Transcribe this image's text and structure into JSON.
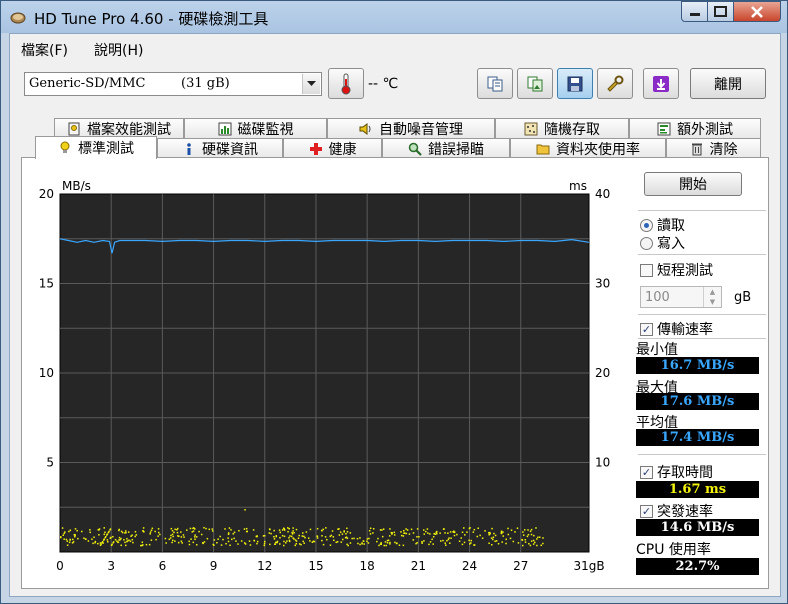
{
  "window": {
    "title": "HD Tune Pro 4.60 - 硬碟檢測工具"
  },
  "menu": {
    "file": "檔案(F)",
    "help": "說明(H)"
  },
  "toolbar": {
    "drive_name": "Generic-SD/MMC",
    "drive_size": "(31 gB)",
    "temperature": "-- ℃",
    "exit_label": "離開"
  },
  "tabs_top": [
    "檔案效能測試",
    "磁碟監視",
    "自動噪音管理",
    "隨機存取",
    "額外測試"
  ],
  "tabs_bottom": [
    "標準測試",
    "硬碟資訊",
    "健康",
    "錯誤掃瞄",
    "資料夾使用率",
    "清除"
  ],
  "colors": {
    "accent": "#3aa7ff",
    "access_dots": "#f4f40b",
    "chart_bg": "#262626"
  },
  "side": {
    "start_label": "開始",
    "read_label": "讀取",
    "write_label": "寫入",
    "read_selected": true,
    "short_test_label": "短程測試",
    "short_test_value": "100",
    "short_test_unit": "gB",
    "transfer_label": "傳輸速率",
    "min_label": "最小值",
    "min_value": "16.7 MB/s",
    "max_label": "最大值",
    "max_value": "17.6 MB/s",
    "avg_label": "平均值",
    "avg_value": "17.4 MB/s",
    "access_label": "存取時間",
    "access_value": "1.67 ms",
    "burst_label": "突發速率",
    "burst_value": "14.6 MB/s",
    "cpu_label": "CPU 使用率",
    "cpu_value": "22.7%"
  },
  "chart_data": {
    "type": "line",
    "ylabel_left": "MB/s",
    "ylabel_right": "ms",
    "xlabel": "gB",
    "xlim": [
      0,
      31
    ],
    "ylim_left": [
      0,
      20
    ],
    "ylim_right": [
      0,
      40
    ],
    "x_ticks": [
      "0",
      "3",
      "6",
      "9",
      "12",
      "15",
      "18",
      "21",
      "24",
      "27",
      "31gB"
    ],
    "y_ticks_left": [
      "20",
      "15",
      "10",
      "5"
    ],
    "y_ticks_right": [
      "40",
      "30",
      "20",
      "10"
    ],
    "grid": true,
    "series": [
      {
        "name": "傳輸速率",
        "axis": "left",
        "x": [
          0,
          0.5,
          1,
          1.5,
          2,
          2.5,
          2.9,
          3.05,
          3.2,
          3.5,
          4,
          5,
          6,
          7,
          8,
          9,
          10,
          11,
          12,
          13,
          14,
          15,
          16,
          17,
          18,
          19,
          20,
          21,
          22,
          23,
          24,
          25,
          26,
          27,
          28,
          29,
          30,
          31
        ],
        "values": [
          17.5,
          17.4,
          17.3,
          17.4,
          17.3,
          17.4,
          17.35,
          16.7,
          17.3,
          17.4,
          17.4,
          17.4,
          17.35,
          17.4,
          17.4,
          17.35,
          17.4,
          17.4,
          17.35,
          17.4,
          17.4,
          17.35,
          17.4,
          17.4,
          17.4,
          17.35,
          17.4,
          17.4,
          17.35,
          17.4,
          17.4,
          17.4,
          17.35,
          17.4,
          17.4,
          17.35,
          17.45,
          17.3
        ]
      },
      {
        "name": "存取時間",
        "axis": "right",
        "type": "scatter",
        "x_range": [
          0,
          28.5
        ],
        "y_range": [
          0.8,
          2.8
        ],
        "outlier": [
          10.8,
          4.8
        ]
      }
    ]
  }
}
